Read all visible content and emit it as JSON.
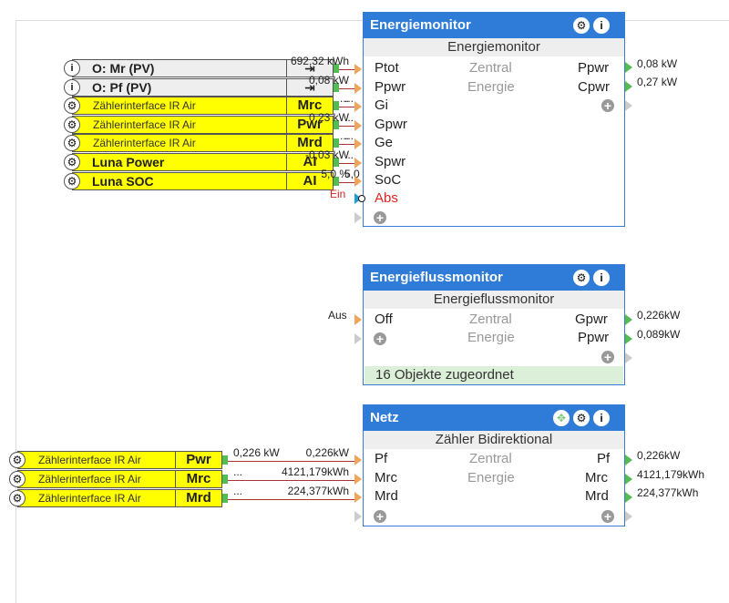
{
  "colors": {
    "header_blue": "#2f7cd8",
    "input_port": "#f0a55a",
    "output_port": "#55bb55",
    "wire": "#aa3333",
    "source_yellow": "#ffff00",
    "footer_green": "#dcefd8"
  },
  "top_sources": [
    {
      "icon": "info-icon",
      "glyph": "i",
      "name": "O: Mr (PV)",
      "output": "⇥",
      "wire_left": "",
      "wire_right": "692,32 kWh"
    },
    {
      "icon": "info-icon",
      "glyph": "i",
      "name": "O: Pf (PV)",
      "output": "⇥",
      "wire_left": "",
      "wire_right": "0,08 kW"
    },
    {
      "icon": "gear-icon",
      "glyph": "⚙",
      "name": "Zählerinterface IR Air",
      "output": "Mrc",
      "wire_left": "...",
      "wire_right": "..."
    },
    {
      "icon": "gear-icon",
      "glyph": "⚙",
      "name": "Zählerinterface IR Air",
      "output": "Pwr",
      "wire_left": "...",
      "wire_right": "0,23 kW"
    },
    {
      "icon": "gear-icon",
      "glyph": "⚙",
      "name": "Zählerinterface IR Air",
      "output": "Mrd",
      "wire_left": "...",
      "wire_right": "..."
    },
    {
      "icon": "gear-icon",
      "glyph": "⚙",
      "name": "Luna Power",
      "output": "AI",
      "wire_left": "...",
      "wire_right": "-0,03 kW"
    },
    {
      "icon": "gear-icon",
      "glyph": "⚙",
      "name": "Luna SOC",
      "output": "AI",
      "wire_left": "5,0",
      "wire_right": "5,0 %"
    }
  ],
  "energiemonitor": {
    "title": "Energiemonitor",
    "subtitle": "Energiemonitor",
    "center1": "Zentral",
    "center2": "Energie",
    "inputs": [
      "Ptot",
      "Ppwr",
      "Gi",
      "Gpwr",
      "Ge",
      "Spwr",
      "SoC",
      "Abs"
    ],
    "abs_input_label": "Ein",
    "outputs": [
      "Ppwr",
      "Cpwr"
    ],
    "output_values": [
      "0,08 kW",
      "0,27 kW"
    ],
    "settings_glyph": "⚙",
    "info_glyph": "i",
    "plus": "+"
  },
  "energieflussmonitor": {
    "title": "Energieflussmonitor",
    "subtitle": "Energieflussmonitor",
    "center1": "Zentral",
    "center2": "Energie",
    "inputs": [
      "Off"
    ],
    "off_input_label": "Aus",
    "outputs": [
      "Gpwr",
      "Ppwr"
    ],
    "output_values": [
      "0,226kW",
      "0,089kW"
    ],
    "footer": "16 Objekte zugeordnet",
    "settings_glyph": "⚙",
    "info_glyph": "i",
    "plus": "+"
  },
  "netz": {
    "title": "Netz",
    "subtitle": "Zähler Bidirektional",
    "center1": "Zentral",
    "center2": "Energie",
    "inputs": [
      "Pf",
      "Mrc",
      "Mrd"
    ],
    "outputs": [
      "Pf",
      "Mrc",
      "Mrd"
    ],
    "output_values": [
      "0,226kW",
      "4121,179kWh",
      "224,377kWh"
    ],
    "move_glyph": "✥",
    "settings_glyph": "⚙",
    "info_glyph": "i",
    "plus": "+"
  },
  "bottom_sources": [
    {
      "icon": "gear-icon",
      "glyph": "⚙",
      "name": "Zählerinterface IR Air",
      "output": "Pwr",
      "wire_left": "0,226 kW",
      "wire_right": "0,226kW"
    },
    {
      "icon": "gear-icon",
      "glyph": "⚙",
      "name": "Zählerinterface IR Air",
      "output": "Mrc",
      "wire_left": "...",
      "wire_right": "4121,179kWh"
    },
    {
      "icon": "gear-icon",
      "glyph": "⚙",
      "name": "Zählerinterface IR Air",
      "output": "Mrd",
      "wire_left": "...",
      "wire_right": "224,377kWh"
    }
  ]
}
